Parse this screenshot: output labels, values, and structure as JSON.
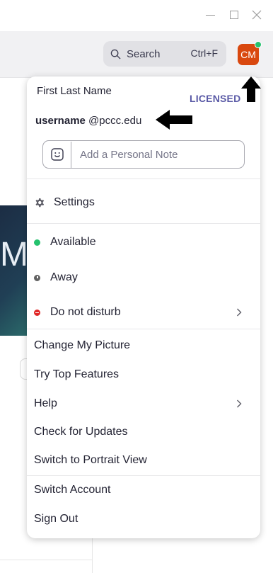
{
  "search": {
    "label": "Search",
    "shortcut": "Ctrl+F"
  },
  "avatar": {
    "initials": "CM",
    "status_color": "#25c26e"
  },
  "background": {
    "big_letter": "M"
  },
  "profile": {
    "name": "First Last Name",
    "badge": "LICENSED",
    "username": "username",
    "domain": "@pccc.edu",
    "note_placeholder": "Add a Personal Note"
  },
  "menu": {
    "settings": "Settings",
    "available": "Available",
    "away": "Away",
    "dnd": "Do not disturb",
    "change_picture": "Change My Picture",
    "try_features": "Try Top Features",
    "help": "Help",
    "check_updates": "Check for Updates",
    "portrait_view": "Switch to Portrait View",
    "switch_account": "Switch Account",
    "sign_out": "Sign Out"
  },
  "icons": {
    "minimize": "minimize-icon",
    "maximize": "maximize-icon",
    "close": "close-icon",
    "search": "search-icon",
    "emoji": "smiley-icon",
    "gear": "gear-icon",
    "chevron": "chevron-right-icon",
    "annotation_arrows": "black-arrow-icon"
  },
  "colors": {
    "avatar_bg": "#d9480f",
    "available": "#25c26e",
    "away": "#616161",
    "dnd": "#e02828",
    "licensed": "#5a5aa6"
  }
}
